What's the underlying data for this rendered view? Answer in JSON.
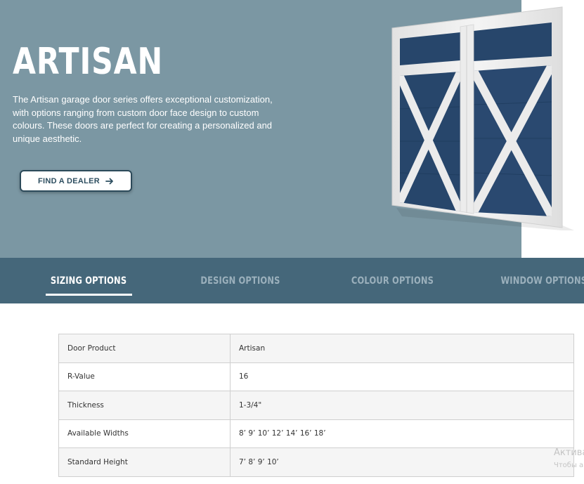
{
  "hero": {
    "title": "ARTISAN",
    "description": "The Artisan garage door series offers exceptional customization, with options ranging from custom door face design to custom colours. These doors are perfect for creating a personalized and unique aesthetic.",
    "cta_label": "FIND A DEALER",
    "cta_icon": "arrow-right-icon",
    "background_color": "#7b97a3",
    "door_panel_color": "#27466b"
  },
  "tabs": [
    {
      "label": "SIZING OPTIONS",
      "active": true
    },
    {
      "label": "DESIGN OPTIONS",
      "active": false
    },
    {
      "label": "COLOUR OPTIONS",
      "active": false
    },
    {
      "label": "WINDOW OPTIONS",
      "active": false
    }
  ],
  "tab_bar_color": "#45677a",
  "specs": [
    {
      "label": "Door Product",
      "value": "Artisan"
    },
    {
      "label": "R-Value",
      "value": "16"
    },
    {
      "label": "Thickness",
      "value": "1-3/4\""
    },
    {
      "label": "Available Widths",
      "value": "8’ 9’ 10’ 12’ 14’ 16’ 18’"
    },
    {
      "label": "Standard Height",
      "value": "7’ 8’ 9’ 10’"
    }
  ],
  "watermark": {
    "line1": "Актива",
    "line2": "Чтобы а"
  }
}
